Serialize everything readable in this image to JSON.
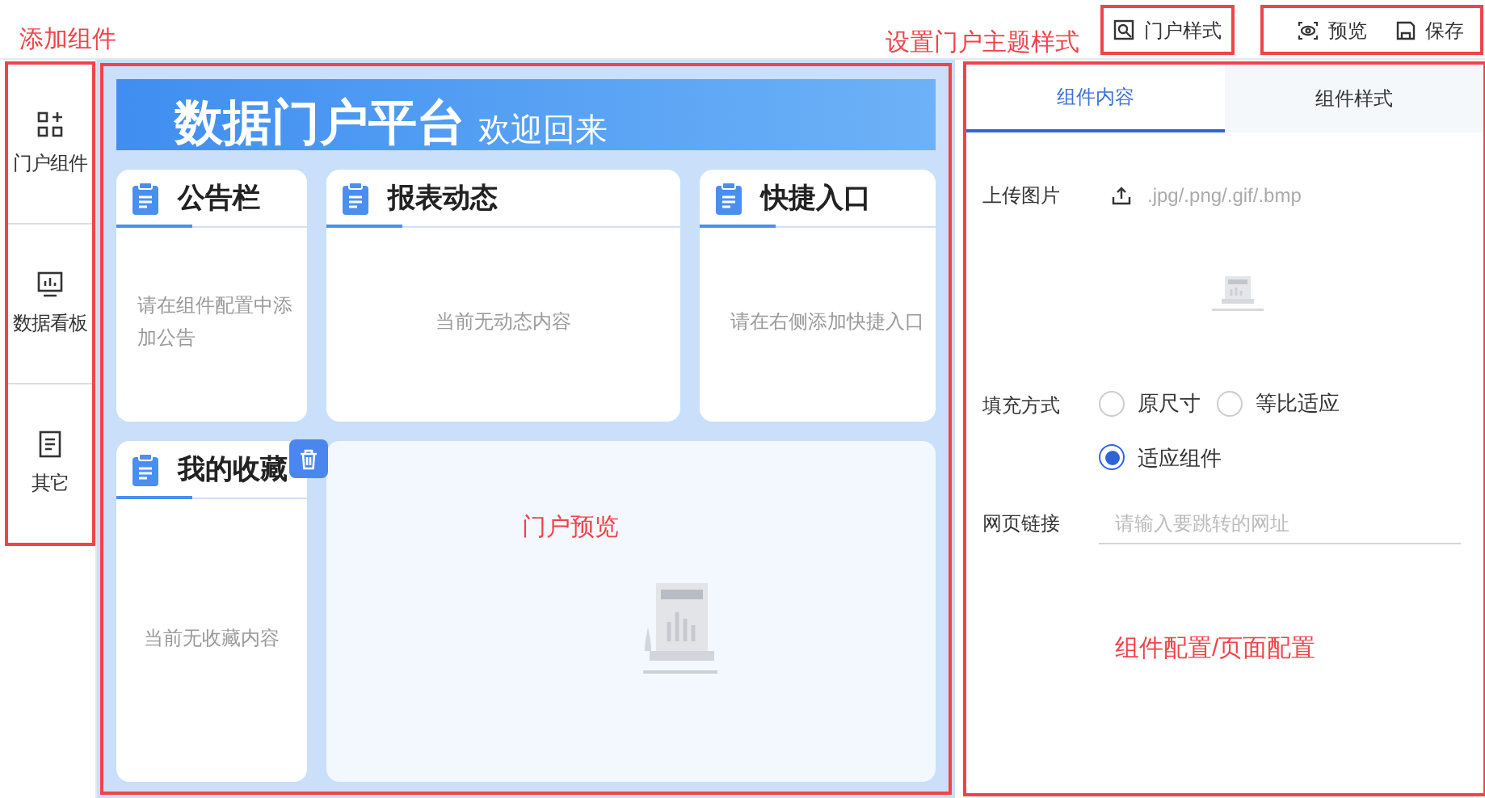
{
  "top_bar": {
    "annotation": "设置门户主题样式",
    "theme_button": "门户样式",
    "actions": [
      "预览",
      "保存"
    ]
  },
  "sidebar": {
    "annotation": "添加组件",
    "items": [
      {
        "label": "门户组件"
      },
      {
        "label": "数据看板"
      },
      {
        "label": "其它"
      }
    ]
  },
  "canvas": {
    "annotation": "门户预览",
    "banner": {
      "title": "数据门户平台",
      "subtitle": "欢迎回来"
    },
    "cards": [
      {
        "title": "公告栏",
        "message": "请在组件配置中添加公告",
        "selected": false
      },
      {
        "title": "报表动态",
        "message": "当前无动态内容",
        "selected": false
      },
      {
        "title": "快捷入口",
        "message": "请在右侧添加快捷入口",
        "selected": false
      },
      {
        "title": "我的收藏",
        "message": "当前无收藏内容",
        "selected": true
      }
    ]
  },
  "config_panel": {
    "annotation": "组件配置/页面配置",
    "tabs": [
      {
        "label": "组件内容",
        "selected": true
      },
      {
        "label": "组件样式",
        "selected": false
      }
    ],
    "upload": {
      "label": "上传图片",
      "hint": ".jpg/.png/.gif/.bmp"
    },
    "fill": {
      "label": "填充方式",
      "options": [
        {
          "label": "原尺寸",
          "selected": false
        },
        {
          "label": "等比适应",
          "selected": false
        },
        {
          "label": "适应组件",
          "selected": true
        }
      ]
    },
    "link": {
      "label": "网页链接",
      "placeholder": "请输入要跳转的网址"
    }
  }
}
